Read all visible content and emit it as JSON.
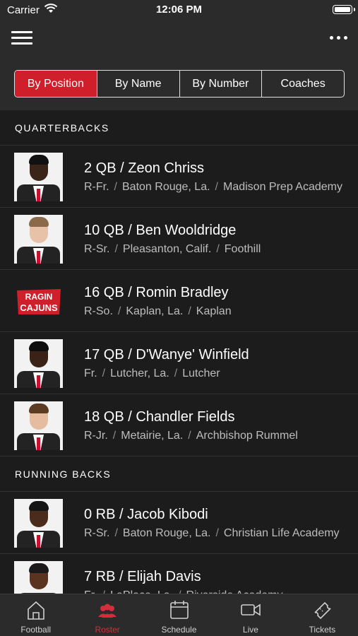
{
  "status_bar": {
    "carrier": "Carrier",
    "time": "12:06 PM",
    "wifi_icon": "wifi-icon",
    "battery_icon": "battery-icon"
  },
  "header": {
    "menu_icon": "hamburger-menu-icon",
    "more_icon": "more-dots-icon"
  },
  "segments": [
    {
      "label": "By Position",
      "active": true
    },
    {
      "label": "By Name",
      "active": false
    },
    {
      "label": "By Number",
      "active": false
    },
    {
      "label": "Coaches",
      "active": false
    }
  ],
  "sections": [
    {
      "title": "QUARTERBACKS",
      "players": [
        {
          "name": "2 QB / Zeon Chriss",
          "class": "R-Fr.",
          "hometown": "Baton Rouge, La.",
          "school": "Madison Prep Academy",
          "photo": "player-photo"
        },
        {
          "name": "10 QB / Ben Wooldridge",
          "class": "R-Sr.",
          "hometown": "Pleasanton, Calif.",
          "school": "Foothill",
          "photo": "player-photo"
        },
        {
          "name": "16 QB / Romin Bradley",
          "class": "R-So.",
          "hometown": "Kaplan, La.",
          "school": "Kaplan",
          "photo": "team-logo",
          "logo_text": [
            "RAGIN",
            "CAJUNS"
          ]
        },
        {
          "name": "17 QB / D'Wanye' Winfield",
          "class": "Fr.",
          "hometown": "Lutcher, La.",
          "school": "Lutcher",
          "photo": "player-photo"
        },
        {
          "name": "18 QB / Chandler Fields",
          "class": "R-Jr.",
          "hometown": "Metairie, La.",
          "school": "Archbishop Rummel",
          "photo": "player-photo"
        }
      ]
    },
    {
      "title": "RUNNING BACKS",
      "players": [
        {
          "name": "0 RB / Jacob Kibodi",
          "class": "R-Sr.",
          "hometown": "Baton Rouge, La.",
          "school": "Christian Life Academy",
          "photo": "player-photo"
        },
        {
          "name": "7 RB / Elijah Davis",
          "class": "Fr.",
          "hometown": "LaPlace, La.",
          "school": "Riverside Academy",
          "photo": "player-photo"
        }
      ]
    }
  ],
  "tabs": [
    {
      "label": "Football",
      "icon": "football-home-icon",
      "active": false
    },
    {
      "label": "Roster",
      "icon": "roster-people-icon",
      "active": true
    },
    {
      "label": "Schedule",
      "icon": "calendar-icon",
      "active": false
    },
    {
      "label": "Live",
      "icon": "video-camera-icon",
      "active": false
    },
    {
      "label": "Tickets",
      "icon": "ticket-icon",
      "active": false
    }
  ],
  "colors": {
    "accent": "#ce1f2b",
    "background": "#1c1c1c",
    "bar": "#2b2b2b",
    "tab_active": "#d32f3b"
  }
}
